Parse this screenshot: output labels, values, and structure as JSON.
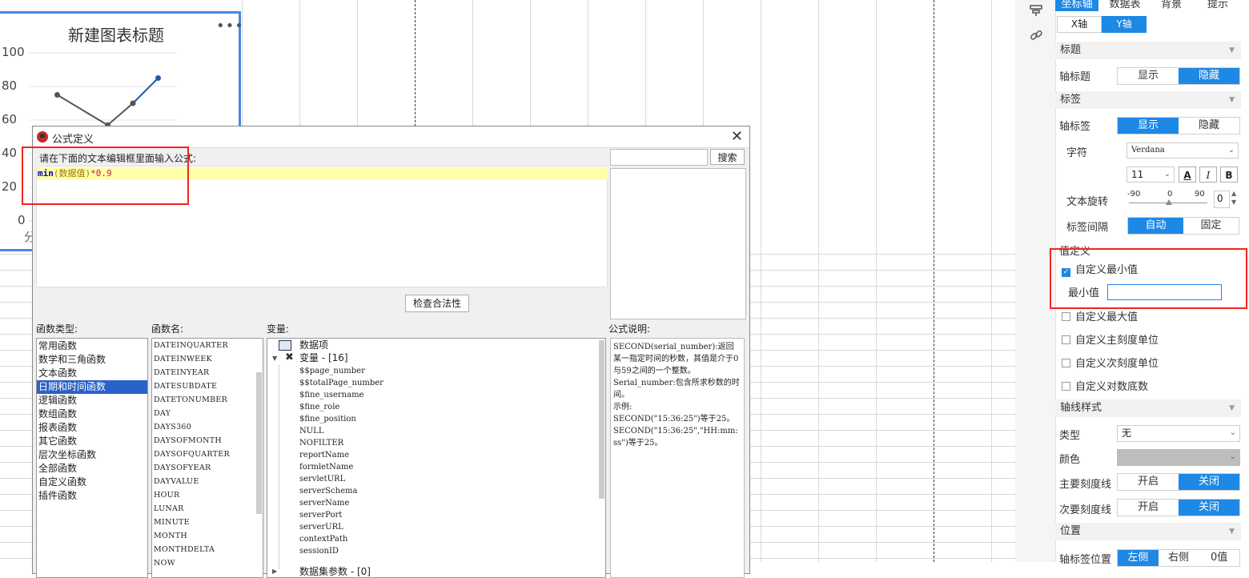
{
  "chart": {
    "title": "新建图表标题",
    "more": "•••",
    "yticks": [
      "100",
      "80",
      "60",
      "40",
      "20",
      "0"
    ],
    "x_first_label_partial": "分",
    "series_values": [
      null,
      75,
      null,
      57,
      70,
      85
    ]
  },
  "toolstrip": {
    "icons": [
      "paste-style-icon",
      "link-icon"
    ]
  },
  "panel": {
    "tabs": [
      "坐标轴",
      "数据表",
      "背景",
      "提示"
    ],
    "axis_tabs": [
      "X轴",
      "Y轴"
    ],
    "sections": {
      "title": "标题",
      "label": "标签",
      "value_def": "值定义",
      "axis_style": "轴线样式",
      "position": "位置"
    },
    "axis_title": {
      "label": "轴标题",
      "options": [
        "显示",
        "隐藏"
      ]
    },
    "axis_label": {
      "label": "轴标签",
      "options": [
        "显示",
        "隐藏"
      ]
    },
    "font": {
      "label": "字符",
      "family": "Verdana",
      "size": "11",
      "bold": "B",
      "italic": "I",
      "color": "A"
    },
    "rotation": {
      "label": "文本旋转",
      "min": "-90",
      "mid": "0",
      "max": "90",
      "value": "0"
    },
    "interval": {
      "label": "标签间隔",
      "options": [
        "自动",
        "固定"
      ]
    },
    "value_def": {
      "custom_min": "自定义最小值",
      "min_label": "最小值",
      "min_value": "",
      "custom_max": "自定义最大值",
      "custom_major": "自定义主刻度单位",
      "custom_minor": "自定义次刻度单位",
      "custom_log": "自定义对数底数"
    },
    "axis_style": {
      "type_label": "类型",
      "type_value": "无",
      "color_label": "颜色",
      "major_label": "主要刻度线",
      "minor_label": "次要刻度线",
      "options": [
        "开启",
        "关闭"
      ]
    },
    "position": {
      "label": "轴标签位置",
      "options": [
        "左侧",
        "右侧",
        "0值"
      ]
    }
  },
  "dialog": {
    "title": "公式定义",
    "hint": "请在下面的文本编辑框里面输入公式:",
    "formula": {
      "fn": "min",
      "open": "(",
      "var": "数据值",
      "close": ")",
      "op": "*",
      "num": "0.9"
    },
    "search_button": "搜索",
    "check_button": "检查合法性",
    "headers": {
      "types": "函数类型:",
      "names": "函数名:",
      "vars": "变量:",
      "desc": "公式说明:"
    },
    "function_types": [
      "常用函数",
      "数学和三角函数",
      "文本函数",
      "日期和时间函数",
      "逻辑函数",
      "数组函数",
      "报表函数",
      "其它函数",
      "层次坐标函数",
      "全部函数",
      "自定义函数",
      "插件函数"
    ],
    "selected_type_index": 3,
    "function_names": [
      "DATEINQUARTER",
      "DATEINWEEK",
      "DATEINYEAR",
      "DATESUBDATE",
      "DATETONUMBER",
      "DAY",
      "DAYS360",
      "DAYSOFMONTH",
      "DAYSOFQUARTER",
      "DAYSOFYEAR",
      "DAYVALUE",
      "HOUR",
      "LUNAR",
      "MINUTE",
      "MONTH",
      "MONTHDELTA",
      "NOW"
    ],
    "variables": {
      "data_item": "数据项",
      "var_group": "变量 - [16]",
      "items": [
        "$$page_number",
        "$$totalPage_number",
        "$fine_username",
        "$fine_role",
        "$fine_position",
        "NULL",
        "NOFILTER",
        "reportName",
        "formletName",
        "servletURL",
        "serverSchema",
        "serverName",
        "serverPort",
        "serverURL",
        "contextPath",
        "sessionID"
      ],
      "dataset_group": "数据集参数 - [0]"
    },
    "description": "SECOND(serial_number):返回某一指定时间的秒数，其值是介于0与59之间的一个整数。\nSerial_number:包含所求秒数的时间。\n示例:\nSECOND(\"15:36:25\")等于25。\nSECOND(\"15:36:25\",\"HH:mm:ss\")等于25。"
  }
}
